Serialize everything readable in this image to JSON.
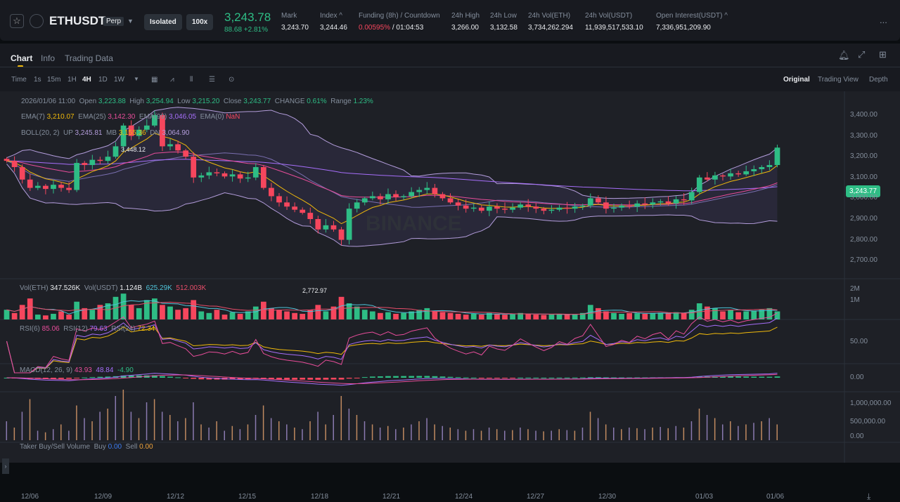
{
  "header": {
    "symbol": "ETHUSDT",
    "contract": "Perp",
    "margin_mode": "Isolated",
    "leverage": "100x",
    "last_price": "3,243.78",
    "change": "88.68 +2.81%",
    "stats": [
      {
        "label": "Mark",
        "value": "3,243.70"
      },
      {
        "label": "Index ^",
        "value": "3,244.46"
      },
      {
        "label": "Funding (8h) / Countdown",
        "value": "0.00595%",
        "value2": " / 01:04:53"
      },
      {
        "label": "24h High",
        "value": "3,266.00"
      },
      {
        "label": "24h Low",
        "value": "3,132.58"
      },
      {
        "label": "24h Vol(ETH)",
        "value": "3,734,262.294"
      },
      {
        "label": "24h Vol(USDT)",
        "value": "11,939,517,533.10"
      },
      {
        "label": "Open Interest(USDT) ^",
        "value": "7,336,951,209.90"
      }
    ],
    "more": "..."
  },
  "tabs": [
    "Chart",
    "Info",
    "Trading Data"
  ],
  "toolbar": {
    "intervals": [
      "Time",
      "1s",
      "15m",
      "1H",
      "4H",
      "1D",
      "1W"
    ],
    "active": "4H",
    "price_type": "Last Price",
    "views": [
      "Original",
      "Trading View",
      "Depth"
    ]
  },
  "legend": {
    "date": "2026/01/06 11:00",
    "open": "3,223.88",
    "high": "3,254.94",
    "low": "3,215.20",
    "close": "3,243.77",
    "change": "0.61%",
    "range": "1.23%",
    "ema7": "3,210.07",
    "ema25": "3,142.30",
    "ema99": "3,046.05",
    "ema0": "NaN",
    "boll_up": "3,245.81",
    "boll_mb": "3,155.36",
    "boll_dn": "3,064.90",
    "vol_eth": "347.526K",
    "vol_usdt": "1.124B",
    "vol_ma1": "625.29K",
    "vol_ma2": "512.003K",
    "rsi6": "85.06",
    "rsi12": "79.63",
    "rsi24": "72.34",
    "macd": "43.93",
    "dif": "48.84",
    "dea": "-4.90",
    "taker_buy": "0.00",
    "taker_sell": "0.00",
    "high_mark": "3,448.12",
    "low_mark": "2,772.97",
    "watermark": "BINANCE"
  },
  "colors": {
    "up": "#2ebd85",
    "down": "#f6465d",
    "ema7": "#f0b90b",
    "ema25": "#e84d9a",
    "ema99": "#a66efa",
    "boll": "#b39ddb"
  },
  "chart_data": {
    "type": "candlestick",
    "ylim": [
      2650,
      3450
    ],
    "y_ticks": [
      "3,400.00",
      "3,300.00",
      "3,200.00",
      "3,100.00",
      "3,000.00",
      "2,900.00",
      "2,800.00",
      "2,700.00"
    ],
    "x_ticks": [
      "12/06",
      "12/09",
      "12/12",
      "12/15",
      "12/18",
      "12/21",
      "12/24",
      "12/27",
      "12/30",
      "01/03",
      "01/06"
    ],
    "current_price": "3,243.77",
    "vol_ticks": [
      "2M",
      "1M"
    ],
    "rsi_ticks": [
      "50.00"
    ],
    "macd_ticks": [
      "0.00"
    ],
    "taker_ticks": [
      "1,000,000.00",
      "500,000.00",
      "0.00"
    ],
    "closes": [
      3180,
      3150,
      3090,
      3050,
      3060,
      3045,
      3065,
      3050,
      3040,
      3170,
      3160,
      3185,
      3180,
      3200,
      3250,
      3350,
      3300,
      3330,
      3350,
      3400,
      3250,
      3260,
      3230,
      3200,
      3100,
      3110,
      3125,
      3120,
      3105,
      3115,
      3095,
      3100,
      3150,
      3050,
      3010,
      2980,
      2960,
      2945,
      2930,
      2900,
      2850,
      2870,
      2850,
      2800,
      2950,
      2980,
      3000,
      3010,
      2995,
      3020,
      3005,
      3010,
      3030,
      3040,
      3050,
      3020,
      3000,
      2980,
      2965,
      2950,
      2955,
      2940,
      2960,
      2950,
      2945,
      2955,
      2970,
      2960,
      2950,
      2940,
      2945,
      2955,
      2950,
      2960,
      2965,
      3000,
      2980,
      2950,
      2955,
      2965,
      2960,
      2975,
      2970,
      2980,
      2985,
      2975,
      2995,
      2990,
      3030,
      3100,
      3090,
      3110,
      3105,
      3120,
      3115,
      3130,
      3140,
      3150,
      3160,
      3243.77
    ],
    "volumes_k": [
      600,
      400,
      900,
      1300,
      300,
      250,
      350,
      500,
      300,
      1100,
      700,
      600,
      900,
      1000,
      1400,
      1600,
      900,
      700,
      1200,
      1300,
      900,
      800,
      600,
      700,
      1200,
      500,
      400,
      600,
      300,
      450,
      350,
      500,
      800,
      1100,
      700,
      600,
      500,
      400,
      350,
      600,
      900,
      500,
      800,
      1400,
      1000,
      800,
      600,
      500,
      400,
      450,
      350,
      400,
      500,
      600,
      700,
      500,
      450,
      400,
      350,
      300,
      350,
      300,
      400,
      350,
      300,
      320,
      400,
      350,
      300,
      280,
      300,
      350,
      320,
      300,
      400,
      900,
      700,
      500,
      400,
      350,
      400,
      380,
      350,
      400,
      420,
      380,
      450,
      400,
      600,
      1000,
      800,
      700,
      500,
      600,
      450,
      500,
      550,
      600,
      700,
      500
    ]
  }
}
